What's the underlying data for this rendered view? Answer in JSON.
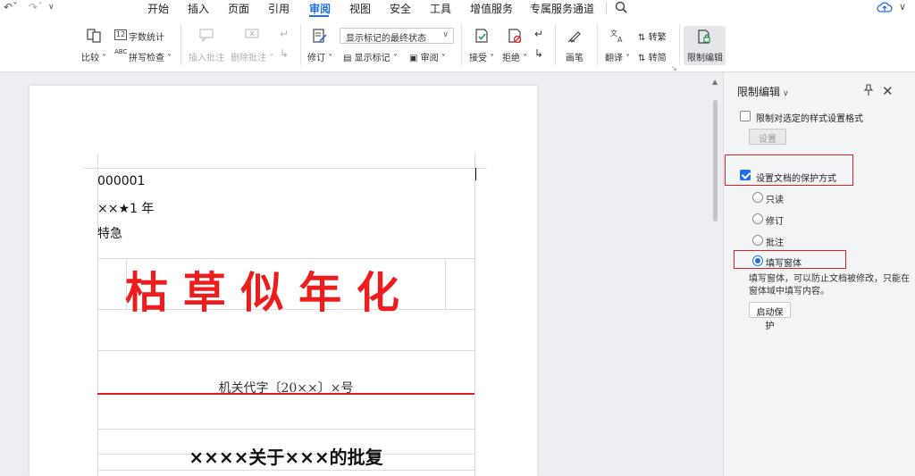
{
  "menubar": {
    "tabs": [
      "开始",
      "插入",
      "页面",
      "引用",
      "审阅",
      "视图",
      "安全",
      "工具",
      "增值服务",
      "专属服务通道"
    ],
    "active_tab": "审阅"
  },
  "ribbon": {
    "compare": "比较",
    "word_count": "字数统计",
    "spell_check": "拼写检查",
    "insert_comment": "插入批注",
    "delete_comment": "删除批注",
    "track_changes": "修订",
    "display_state": "显示标记的最终状态",
    "show_markup": "显示标记",
    "review": "审阅",
    "accept": "接受",
    "reject": "拒绝",
    "pen": "画笔",
    "translate": "翻译",
    "to_traditional": "转繁",
    "to_simplified": "转简",
    "restrict_edit": "限制编辑",
    "abc": "ABC",
    "twelve": "12"
  },
  "document": {
    "serial": "000001",
    "secret_level": "××★1 年",
    "urgency": "特急",
    "red_header": "枯 草 似 年 化",
    "doc_number": "机关代字〔20××〕×号",
    "reply_title": "××××关于×××的批复"
  },
  "panel": {
    "title": "限制编辑",
    "limit_format": "限制对选定的样式设置格式",
    "settings_button": "设置",
    "protect_method": "设置文档的保护方式",
    "options": [
      "只读",
      "修订",
      "批注",
      "填写窗体"
    ],
    "selected_option": "填写窗体",
    "description": "填写窗体，可以防止文档被修改，只能在窗体域中填写内容。",
    "start_button": "启动保护"
  },
  "colors": {
    "accent": "#1f6fe6",
    "red": "#ee1c1c"
  }
}
